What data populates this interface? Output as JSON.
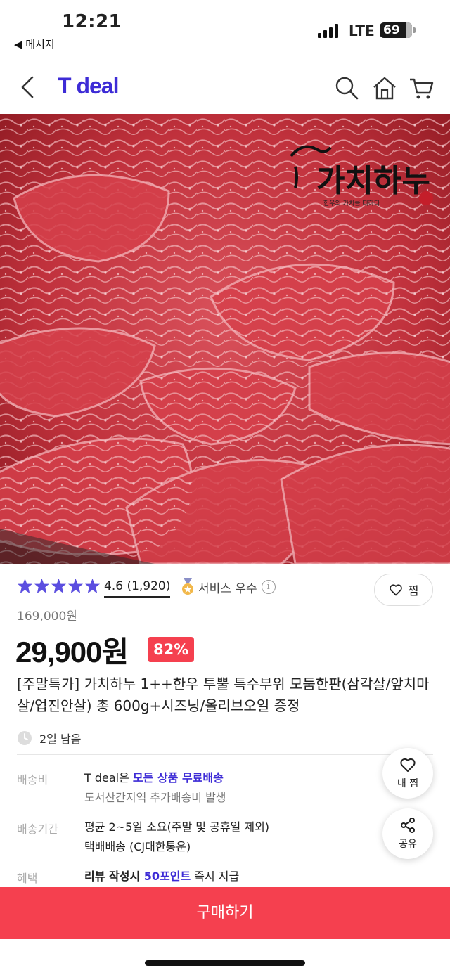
{
  "status_bar": {
    "time": "12:21",
    "back_app": "◀ 메시지",
    "network": "LTE",
    "battery": "69"
  },
  "header": {
    "logo": "T deal",
    "icons": [
      "back-arrow-icon",
      "search-icon",
      "home-icon",
      "cart-icon"
    ],
    "brand_color": "#3d2bd6"
  },
  "product": {
    "rating": "4.6",
    "review_count": "(1,920)",
    "rating_stars": 5,
    "service_badge": "서비스 우수",
    "wish_label": "찜",
    "original_price": "169,000원",
    "price": "29,900원",
    "discount": "82%",
    "title": "[주말특가] 가치하누 1++한우 투뿔 특수부위 모둠한판(삼각살/앞치마살/업진안살) 총 600g+시즈닝/올리브오일 증정",
    "remaining": "2일 남음"
  },
  "shipping": {
    "fee_label": "배송비",
    "fee_prefix": "T deal은 ",
    "fee_highlight": "모든 상품 무료배송",
    "fee_note": "도서산간지역 추가배송비 발생",
    "period_label": "배송기간",
    "period_line1": "평균 2~5일 소요(주말 및 공휴일 제외)",
    "period_line2": "택배배송 (CJ대한통운)",
    "benefit_label": "혜택",
    "benefit_bold": "리뷰 작성시 ",
    "benefit_highlight": "50포인트",
    "benefit_suffix": " 즉시 지급"
  },
  "floating": {
    "my_wish": "내 찜",
    "share": "공유"
  },
  "buy_button": "구매하기",
  "colors": {
    "accent_red": "#f5404f",
    "star": "#5b4ee0"
  }
}
